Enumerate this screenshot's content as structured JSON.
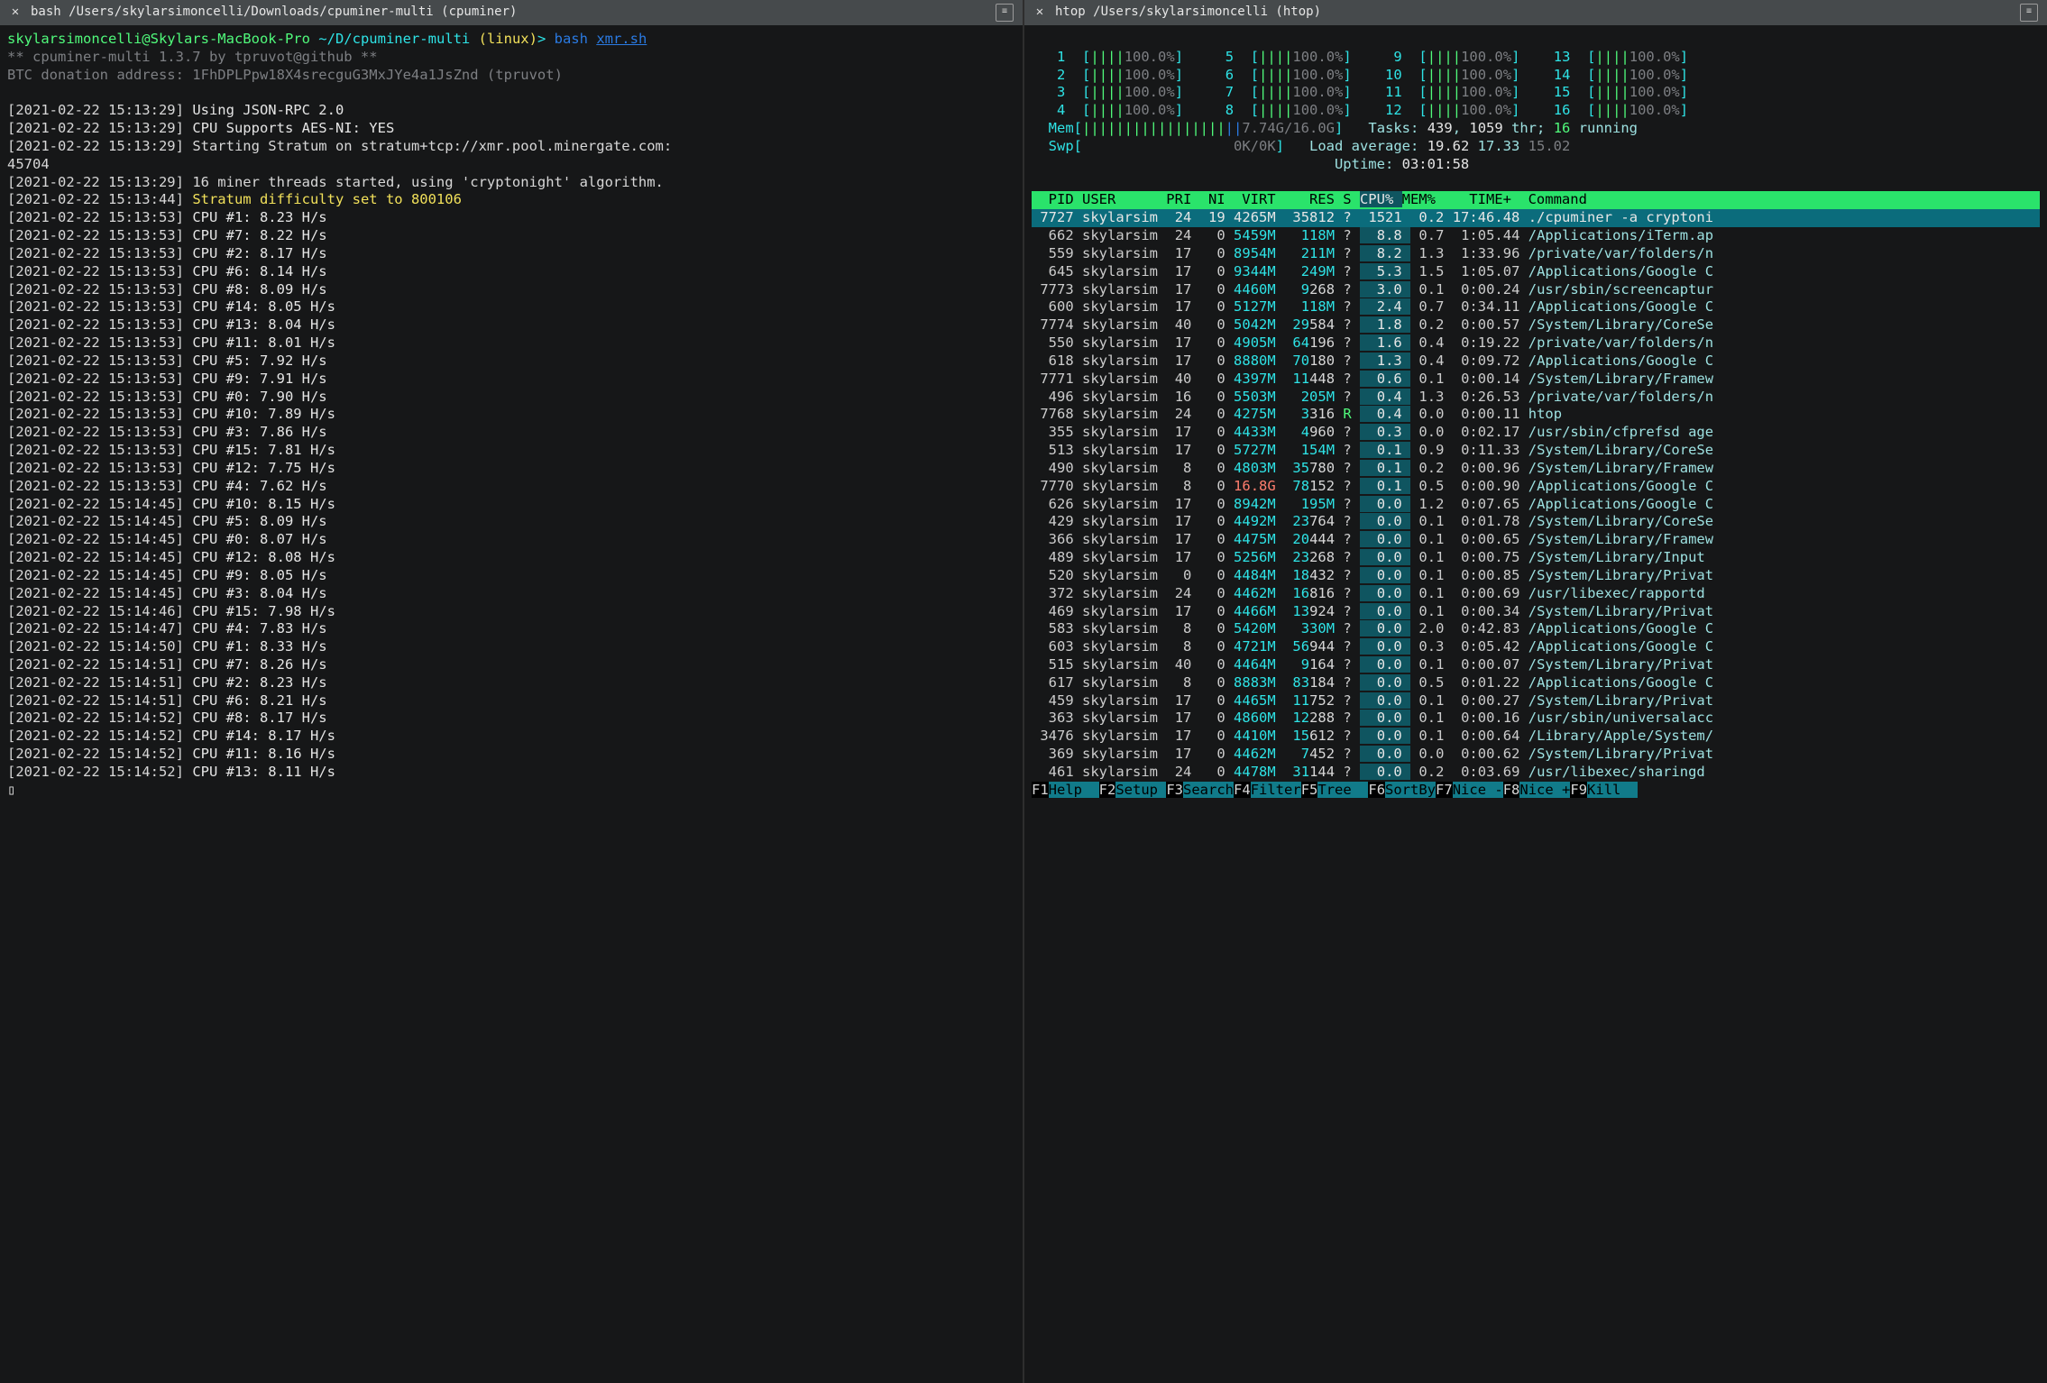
{
  "left": {
    "tab": {
      "title": "bash /Users/skylarsimoncelli/Downloads/cpuminer-multi (cpuminer)"
    },
    "prompt": {
      "user_host": "skylarsimoncelli@Skylars-MacBook-Pro",
      "cwd": "~/D/cpuminer-multi",
      "os": "(linux)",
      "sep": ">",
      "cmd_prefix": "bash",
      "cmd_script": "xmr.sh"
    },
    "banner1": "** cpuminer-multi 1.3.7 by tpruvot@github **",
    "banner2": "BTC donation address: 1FhDPLPpw18X4srecguG3MxJYe4a1JsZnd (tpruvot)",
    "log_lines": [
      {
        "ts": "[2021-02-22 15:13:29]",
        "msg": "Using JSON-RPC 2.0",
        "cls": "c-white"
      },
      {
        "ts": "[2021-02-22 15:13:29]",
        "msg": "CPU Supports AES-NI: YES",
        "cls": "c-white"
      },
      {
        "ts": "[2021-02-22 15:13:29]",
        "msg": "Starting Stratum on stratum+tcp://xmr.pool.minergate.com:",
        "cls": "c-white2"
      },
      {
        "ts": "",
        "msg": "45704",
        "cls": "c-white2"
      },
      {
        "ts": "[2021-02-22 15:13:29]",
        "msg": "16 miner threads started, using 'cryptonight' algorithm.",
        "cls": "c-white2"
      },
      {
        "ts": "[2021-02-22 15:13:44]",
        "msg": "Stratum difficulty set to 800106",
        "cls": "c-yellow"
      },
      {
        "ts": "[2021-02-22 15:13:53]",
        "msg": "CPU #1: 8.23 H/s",
        "cls": "c-white"
      },
      {
        "ts": "[2021-02-22 15:13:53]",
        "msg": "CPU #7: 8.22 H/s",
        "cls": "c-white"
      },
      {
        "ts": "[2021-02-22 15:13:53]",
        "msg": "CPU #2: 8.17 H/s",
        "cls": "c-white"
      },
      {
        "ts": "[2021-02-22 15:13:53]",
        "msg": "CPU #6: 8.14 H/s",
        "cls": "c-white"
      },
      {
        "ts": "[2021-02-22 15:13:53]",
        "msg": "CPU #8: 8.09 H/s",
        "cls": "c-white"
      },
      {
        "ts": "[2021-02-22 15:13:53]",
        "msg": "CPU #14: 8.05 H/s",
        "cls": "c-white"
      },
      {
        "ts": "[2021-02-22 15:13:53]",
        "msg": "CPU #13: 8.04 H/s",
        "cls": "c-white"
      },
      {
        "ts": "[2021-02-22 15:13:53]",
        "msg": "CPU #11: 8.01 H/s",
        "cls": "c-white"
      },
      {
        "ts": "[2021-02-22 15:13:53]",
        "msg": "CPU #5: 7.92 H/s",
        "cls": "c-white"
      },
      {
        "ts": "[2021-02-22 15:13:53]",
        "msg": "CPU #9: 7.91 H/s",
        "cls": "c-white"
      },
      {
        "ts": "[2021-02-22 15:13:53]",
        "msg": "CPU #0: 7.90 H/s",
        "cls": "c-white"
      },
      {
        "ts": "[2021-02-22 15:13:53]",
        "msg": "CPU #10: 7.89 H/s",
        "cls": "c-white"
      },
      {
        "ts": "[2021-02-22 15:13:53]",
        "msg": "CPU #3: 7.86 H/s",
        "cls": "c-white"
      },
      {
        "ts": "[2021-02-22 15:13:53]",
        "msg": "CPU #15: 7.81 H/s",
        "cls": "c-white"
      },
      {
        "ts": "[2021-02-22 15:13:53]",
        "msg": "CPU #12: 7.75 H/s",
        "cls": "c-white"
      },
      {
        "ts": "[2021-02-22 15:13:53]",
        "msg": "CPU #4: 7.62 H/s",
        "cls": "c-white"
      },
      {
        "ts": "[2021-02-22 15:14:45]",
        "msg": "CPU #10: 8.15 H/s",
        "cls": "c-white"
      },
      {
        "ts": "[2021-02-22 15:14:45]",
        "msg": "CPU #5: 8.09 H/s",
        "cls": "c-white"
      },
      {
        "ts": "[2021-02-22 15:14:45]",
        "msg": "CPU #0: 8.07 H/s",
        "cls": "c-white"
      },
      {
        "ts": "[2021-02-22 15:14:45]",
        "msg": "CPU #12: 8.08 H/s",
        "cls": "c-white"
      },
      {
        "ts": "[2021-02-22 15:14:45]",
        "msg": "CPU #9: 8.05 H/s",
        "cls": "c-white"
      },
      {
        "ts": "[2021-02-22 15:14:45]",
        "msg": "CPU #3: 8.04 H/s",
        "cls": "c-white"
      },
      {
        "ts": "[2021-02-22 15:14:46]",
        "msg": "CPU #15: 7.98 H/s",
        "cls": "c-white"
      },
      {
        "ts": "[2021-02-22 15:14:47]",
        "msg": "CPU #4: 7.83 H/s",
        "cls": "c-white"
      },
      {
        "ts": "[2021-02-22 15:14:50]",
        "msg": "CPU #1: 8.33 H/s",
        "cls": "c-white"
      },
      {
        "ts": "[2021-02-22 15:14:51]",
        "msg": "CPU #7: 8.26 H/s",
        "cls": "c-white"
      },
      {
        "ts": "[2021-02-22 15:14:51]",
        "msg": "CPU #2: 8.23 H/s",
        "cls": "c-white"
      },
      {
        "ts": "[2021-02-22 15:14:51]",
        "msg": "CPU #6: 8.21 H/s",
        "cls": "c-white"
      },
      {
        "ts": "[2021-02-22 15:14:52]",
        "msg": "CPU #8: 8.17 H/s",
        "cls": "c-white"
      },
      {
        "ts": "[2021-02-22 15:14:52]",
        "msg": "CPU #14: 8.17 H/s",
        "cls": "c-white"
      },
      {
        "ts": "[2021-02-22 15:14:52]",
        "msg": "CPU #11: 8.16 H/s",
        "cls": "c-white"
      },
      {
        "ts": "[2021-02-22 15:14:52]",
        "msg": "CPU #13: 8.11 H/s",
        "cls": "c-white"
      }
    ],
    "cursor": "▯"
  },
  "right": {
    "tab": {
      "title": "htop /Users/skylarsimoncelli (htop)"
    },
    "cpus": [
      {
        "id": "1",
        "pct": "100.0%"
      },
      {
        "id": "2",
        "pct": "100.0%"
      },
      {
        "id": "3",
        "pct": "100.0%"
      },
      {
        "id": "4",
        "pct": "100.0%"
      },
      {
        "id": "5",
        "pct": "100.0%"
      },
      {
        "id": "6",
        "pct": "100.0%"
      },
      {
        "id": "7",
        "pct": "100.0%"
      },
      {
        "id": "8",
        "pct": "100.0%"
      },
      {
        "id": "9",
        "pct": "100.0%"
      },
      {
        "id": "10",
        "pct": "100.0%"
      },
      {
        "id": "11",
        "pct": "100.0%"
      },
      {
        "id": "12",
        "pct": "100.0%"
      },
      {
        "id": "13",
        "pct": "100.0%"
      },
      {
        "id": "14",
        "pct": "100.0%"
      },
      {
        "id": "15",
        "pct": "100.0%"
      },
      {
        "id": "16",
        "pct": "100.0%"
      }
    ],
    "mem_label": "Mem",
    "mem_used": "7.74G",
    "mem_total": "16.0G",
    "swp_label": "Swp",
    "swp_used": "0K",
    "swp_total": "0K",
    "tasks_label": "Tasks: ",
    "tasks_n": "439",
    "tasks_sep": ", ",
    "threads_n": "1059",
    "tasks_thr": " thr; ",
    "running_n": "16",
    "running_txt": " running",
    "load_label": "Load average: ",
    "load1": "19.62",
    "load2": "17.33",
    "load3": "15.02",
    "uptime_label": "Uptime: ",
    "uptime": "03:01:58",
    "cols": {
      "pid": "PID",
      "user": "USER",
      "pri": "PRI",
      "ni": "NI",
      "virt": "VIRT",
      "res": "RES",
      "s": "S",
      "cpu": "CPU%",
      "mem": "MEM%",
      "time": "TIME+",
      "cmd": "Command"
    },
    "rows": [
      {
        "sel": true,
        "pid": "7727",
        "user": "skylarsim",
        "pri": "24",
        "ni": "19",
        "virt": "4265M",
        "res": "35812",
        "s": "?",
        "cpu": "1521",
        "mem": "0.2",
        "time": "17:46.48",
        "cmd": "./cpuminer -a cryptoni"
      },
      {
        "pid": "662",
        "user": "skylarsim",
        "pri": "24",
        "ni": "0",
        "virt": "5459M",
        "res": "118M",
        "s": "?",
        "cpu": "8.8",
        "mem": "0.7",
        "time": "1:05.44",
        "cmd": "/Applications/iTerm.ap"
      },
      {
        "pid": "559",
        "user": "skylarsim",
        "pri": "17",
        "ni": "0",
        "virt": "8954M",
        "res": "211M",
        "s": "?",
        "cpu": "8.2",
        "mem": "1.3",
        "time": "1:33.96",
        "cmd": "/private/var/folders/n"
      },
      {
        "pid": "645",
        "user": "skylarsim",
        "pri": "17",
        "ni": "0",
        "virt": "9344M",
        "res": "249M",
        "s": "?",
        "cpu": "5.3",
        "mem": "1.5",
        "time": "1:05.07",
        "cmd": "/Applications/Google C"
      },
      {
        "pid": "7773",
        "user": "skylarsim",
        "pri": "17",
        "ni": "0",
        "virt": "4460M",
        "res": "9268",
        "s": "?",
        "cpu": "3.0",
        "mem": "0.1",
        "time": "0:00.24",
        "cmd": "/usr/sbin/screencaptur"
      },
      {
        "pid": "600",
        "user": "skylarsim",
        "pri": "17",
        "ni": "0",
        "virt": "5127M",
        "res": "118M",
        "s": "?",
        "cpu": "2.4",
        "mem": "0.7",
        "time": "0:34.11",
        "cmd": "/Applications/Google C"
      },
      {
        "pid": "7774",
        "user": "skylarsim",
        "pri": "40",
        "ni": "0",
        "virt": "5042M",
        "res": "29584",
        "s": "?",
        "cpu": "1.8",
        "mem": "0.2",
        "time": "0:00.57",
        "cmd": "/System/Library/CoreSe"
      },
      {
        "pid": "550",
        "user": "skylarsim",
        "pri": "17",
        "ni": "0",
        "virt": "4905M",
        "res": "64196",
        "s": "?",
        "cpu": "1.6",
        "mem": "0.4",
        "time": "0:19.22",
        "cmd": "/private/var/folders/n"
      },
      {
        "pid": "618",
        "user": "skylarsim",
        "pri": "17",
        "ni": "0",
        "virt": "8880M",
        "res": "70180",
        "s": "?",
        "cpu": "1.3",
        "mem": "0.4",
        "time": "0:09.72",
        "cmd": "/Applications/Google C"
      },
      {
        "pid": "7771",
        "user": "skylarsim",
        "pri": "40",
        "ni": "0",
        "virt": "4397M",
        "res": "11448",
        "s": "?",
        "cpu": "0.6",
        "mem": "0.1",
        "time": "0:00.14",
        "cmd": "/System/Library/Framew"
      },
      {
        "pid": "496",
        "user": "skylarsim",
        "pri": "16",
        "ni": "0",
        "virt": "5503M",
        "res": "205M",
        "s": "?",
        "cpu": "0.4",
        "mem": "1.3",
        "time": "0:26.53",
        "cmd": "/private/var/folders/n"
      },
      {
        "pid": "7768",
        "user": "skylarsim",
        "pri": "24",
        "ni": "0",
        "virt": "4275M",
        "res": "3316",
        "s": "R",
        "cpu": "0.4",
        "mem": "0.0",
        "time": "0:00.11",
        "cmd": "htop"
      },
      {
        "pid": "355",
        "user": "skylarsim",
        "pri": "17",
        "ni": "0",
        "virt": "4433M",
        "res": "4960",
        "s": "?",
        "cpu": "0.3",
        "mem": "0.0",
        "time": "0:02.17",
        "cmd": "/usr/sbin/cfprefsd age"
      },
      {
        "pid": "513",
        "user": "skylarsim",
        "pri": "17",
        "ni": "0",
        "virt": "5727M",
        "res": "154M",
        "s": "?",
        "cpu": "0.1",
        "mem": "0.9",
        "time": "0:11.33",
        "cmd": "/System/Library/CoreSe"
      },
      {
        "pid": "490",
        "user": "skylarsim",
        "pri": "8",
        "ni": "0",
        "virt": "4803M",
        "res": "35780",
        "s": "?",
        "cpu": "0.1",
        "mem": "0.2",
        "time": "0:00.96",
        "cmd": "/System/Library/Framew"
      },
      {
        "pid": "7770",
        "user": "skylarsim",
        "pri": "8",
        "ni": "0",
        "virt": "16.8G",
        "virt_red": true,
        "res": "78152",
        "s": "?",
        "cpu": "0.1",
        "mem": "0.5",
        "time": "0:00.90",
        "cmd": "/Applications/Google C"
      },
      {
        "pid": "626",
        "user": "skylarsim",
        "pri": "17",
        "ni": "0",
        "virt": "8942M",
        "res": "195M",
        "s": "?",
        "cpu": "0.0",
        "mem": "1.2",
        "time": "0:07.65",
        "cmd": "/Applications/Google C"
      },
      {
        "pid": "429",
        "user": "skylarsim",
        "pri": "17",
        "ni": "0",
        "virt": "4492M",
        "res": "23764",
        "s": "?",
        "cpu": "0.0",
        "mem": "0.1",
        "time": "0:01.78",
        "cmd": "/System/Library/CoreSe"
      },
      {
        "pid": "366",
        "user": "skylarsim",
        "pri": "17",
        "ni": "0",
        "virt": "4475M",
        "res": "20444",
        "s": "?",
        "cpu": "0.0",
        "mem": "0.1",
        "time": "0:00.65",
        "cmd": "/System/Library/Framew"
      },
      {
        "pid": "489",
        "user": "skylarsim",
        "pri": "17",
        "ni": "0",
        "virt": "5256M",
        "res": "23268",
        "s": "?",
        "cpu": "0.0",
        "mem": "0.1",
        "time": "0:00.75",
        "cmd": "/System/Library/Input "
      },
      {
        "pid": "520",
        "user": "skylarsim",
        "pri": "0",
        "ni": "0",
        "virt": "4484M",
        "res": "18432",
        "s": "?",
        "cpu": "0.0",
        "mem": "0.1",
        "time": "0:00.85",
        "cmd": "/System/Library/Privat"
      },
      {
        "pid": "372",
        "user": "skylarsim",
        "pri": "24",
        "ni": "0",
        "virt": "4462M",
        "res": "16816",
        "s": "?",
        "cpu": "0.0",
        "mem": "0.1",
        "time": "0:00.69",
        "cmd": "/usr/libexec/rapportd"
      },
      {
        "pid": "469",
        "user": "skylarsim",
        "pri": "17",
        "ni": "0",
        "virt": "4466M",
        "res": "13924",
        "s": "?",
        "cpu": "0.0",
        "mem": "0.1",
        "time": "0:00.34",
        "cmd": "/System/Library/Privat"
      },
      {
        "pid": "583",
        "user": "skylarsim",
        "pri": "8",
        "ni": "0",
        "virt": "5420M",
        "res": "330M",
        "s": "?",
        "cpu": "0.0",
        "mem": "2.0",
        "time": "0:42.83",
        "cmd": "/Applications/Google C"
      },
      {
        "pid": "603",
        "user": "skylarsim",
        "pri": "8",
        "ni": "0",
        "virt": "4721M",
        "res": "56944",
        "s": "?",
        "cpu": "0.0",
        "mem": "0.3",
        "time": "0:05.42",
        "cmd": "/Applications/Google C"
      },
      {
        "pid": "515",
        "user": "skylarsim",
        "pri": "40",
        "ni": "0",
        "virt": "4464M",
        "res": "9164",
        "s": "?",
        "cpu": "0.0",
        "mem": "0.1",
        "time": "0:00.07",
        "cmd": "/System/Library/Privat"
      },
      {
        "pid": "617",
        "user": "skylarsim",
        "pri": "8",
        "ni": "0",
        "virt": "8883M",
        "res": "83184",
        "s": "?",
        "cpu": "0.0",
        "mem": "0.5",
        "time": "0:01.22",
        "cmd": "/Applications/Google C"
      },
      {
        "pid": "459",
        "user": "skylarsim",
        "pri": "17",
        "ni": "0",
        "virt": "4465M",
        "res": "11752",
        "s": "?",
        "cpu": "0.0",
        "mem": "0.1",
        "time": "0:00.27",
        "cmd": "/System/Library/Privat"
      },
      {
        "pid": "363",
        "user": "skylarsim",
        "pri": "17",
        "ni": "0",
        "virt": "4860M",
        "res": "12288",
        "s": "?",
        "cpu": "0.0",
        "mem": "0.1",
        "time": "0:00.16",
        "cmd": "/usr/sbin/universalacc"
      },
      {
        "pid": "3476",
        "user": "skylarsim",
        "pri": "17",
        "ni": "0",
        "virt": "4410M",
        "res": "15612",
        "s": "?",
        "cpu": "0.0",
        "mem": "0.1",
        "time": "0:00.64",
        "cmd": "/Library/Apple/System/"
      },
      {
        "pid": "369",
        "user": "skylarsim",
        "pri": "17",
        "ni": "0",
        "virt": "4462M",
        "res": "7452",
        "s": "?",
        "cpu": "0.0",
        "mem": "0.0",
        "time": "0:00.62",
        "cmd": "/System/Library/Privat"
      },
      {
        "pid": "461",
        "user": "skylarsim",
        "pri": "24",
        "ni": "0",
        "virt": "4478M",
        "res": "31144",
        "s": "?",
        "cpu": "0.0",
        "mem": "0.2",
        "time": "0:03.69",
        "cmd": "/usr/libexec/sharingd"
      }
    ],
    "fkeys": [
      {
        "k": "F1",
        "t": "Help  "
      },
      {
        "k": "F2",
        "t": "Setup "
      },
      {
        "k": "F3",
        "t": "Search"
      },
      {
        "k": "F4",
        "t": "Filter"
      },
      {
        "k": "F5",
        "t": "Tree  "
      },
      {
        "k": "F6",
        "t": "SortBy"
      },
      {
        "k": "F7",
        "t": "Nice -"
      },
      {
        "k": "F8",
        "t": "Nice +"
      },
      {
        "k": "F9",
        "t": "Kill  "
      }
    ]
  }
}
